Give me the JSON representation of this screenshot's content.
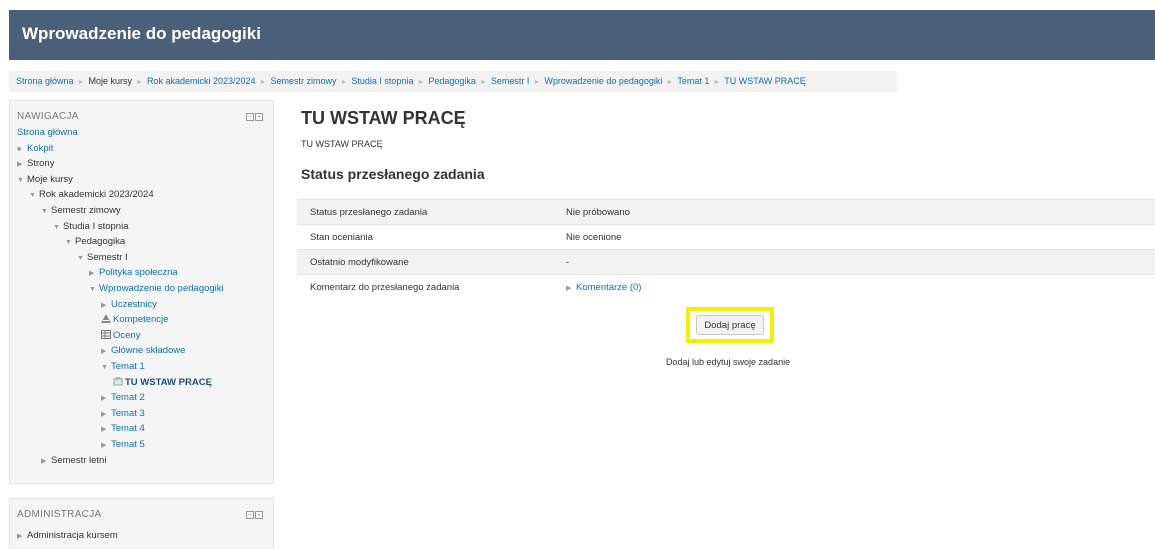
{
  "header": {
    "title": "Wprowadzenie do pedagogiki"
  },
  "breadcrumb": [
    {
      "label": "Strona główna",
      "link": true
    },
    {
      "label": "Moje kursy",
      "link": false
    },
    {
      "label": "Rok akademicki 2023/2024",
      "link": true
    },
    {
      "label": "Semestr zimowy",
      "link": true
    },
    {
      "label": "Studia I stopnia",
      "link": true
    },
    {
      "label": "Pedagogika",
      "link": true
    },
    {
      "label": "Semestr I",
      "link": true
    },
    {
      "label": "Wprowadzenie do pedagogiki",
      "link": true
    },
    {
      "label": "Temat 1",
      "link": true
    },
    {
      "label": "TU WSTAW PRACĘ",
      "link": true
    }
  ],
  "nav": {
    "title": "NAWIGACJA",
    "items": [
      {
        "label": "Strona główna",
        "icon": "none",
        "link": true,
        "bold": false
      },
      {
        "label": "Kokpit",
        "icon": "bullet-icon",
        "link": true,
        "bold": false
      },
      {
        "label": "Strony",
        "icon": "arrow-right-icon",
        "link": false,
        "bold": false
      },
      {
        "label": "Moje kursy",
        "icon": "arrow-down-icon",
        "link": false,
        "bold": false
      },
      {
        "label": "Rok akademicki 2023/2024",
        "icon": "arrow-down-icon",
        "link": false,
        "bold": false
      },
      {
        "label": "Semestr zimowy",
        "icon": "arrow-down-icon",
        "link": false,
        "bold": false
      },
      {
        "label": "Studia I stopnia",
        "icon": "arrow-down-icon",
        "link": false,
        "bold": false
      },
      {
        "label": "Pedagogika",
        "icon": "arrow-down-icon",
        "link": false,
        "bold": false
      },
      {
        "label": "Semestr I",
        "icon": "arrow-down-icon",
        "link": false,
        "bold": false
      },
      {
        "label": "Polityka społeczna",
        "icon": "arrow-right-icon",
        "link": true,
        "bold": false
      },
      {
        "label": "Wprowadzenie do pedagogiki",
        "icon": "arrow-down-icon",
        "link": true,
        "bold": false
      },
      {
        "label": "Uczestnicy",
        "icon": "arrow-right-icon",
        "link": true,
        "bold": false
      },
      {
        "label": "Kompetencje",
        "icon": "competency-icon",
        "link": true,
        "bold": false
      },
      {
        "label": "Oceny",
        "icon": "grades-icon",
        "link": true,
        "bold": false
      },
      {
        "label": "Główne składowe",
        "icon": "arrow-right-icon",
        "link": true,
        "bold": false
      },
      {
        "label": "Temat 1",
        "icon": "arrow-down-icon",
        "link": true,
        "bold": false
      },
      {
        "label": "TU WSTAW PRACĘ",
        "icon": "assignment-icon",
        "link": true,
        "bold": true
      },
      {
        "label": "Temat 2",
        "icon": "arrow-right-icon",
        "link": true,
        "bold": false
      },
      {
        "label": "Temat 3",
        "icon": "arrow-right-icon",
        "link": true,
        "bold": false
      },
      {
        "label": "Temat 4",
        "icon": "arrow-right-icon",
        "link": true,
        "bold": false
      },
      {
        "label": "Temat 5",
        "icon": "arrow-right-icon",
        "link": true,
        "bold": false
      },
      {
        "label": "Semestr letni",
        "icon": "arrow-right-icon",
        "link": false,
        "bold": false
      }
    ]
  },
  "admin": {
    "title": "ADMINISTRACJA",
    "items": [
      {
        "label": "Administracja kursem",
        "icon": "arrow-right-icon"
      }
    ]
  },
  "main": {
    "title": "TU WSTAW PRACĘ",
    "description": "TU WSTAW PRACĘ",
    "status_heading": "Status przesłanego zadania",
    "rows": [
      {
        "key": "Status przesłanego zadania",
        "value": "Nie próbowano",
        "link": false
      },
      {
        "key": "Stan oceniania",
        "value": "Nie ocenione",
        "link": false
      },
      {
        "key": "Ostatnio modyfikowane",
        "value": "-",
        "link": false
      },
      {
        "key": "Komentarz do przesłanego zadania",
        "value": "Komentarze (0)",
        "link": true
      }
    ],
    "add_button": "Dodaj pracę",
    "button_hint": "Dodaj lub edytuj swoje zadanie"
  },
  "colors": {
    "header_bg": "#4a5f78",
    "link": "#0f6fb3",
    "highlight": "#f4f000"
  }
}
